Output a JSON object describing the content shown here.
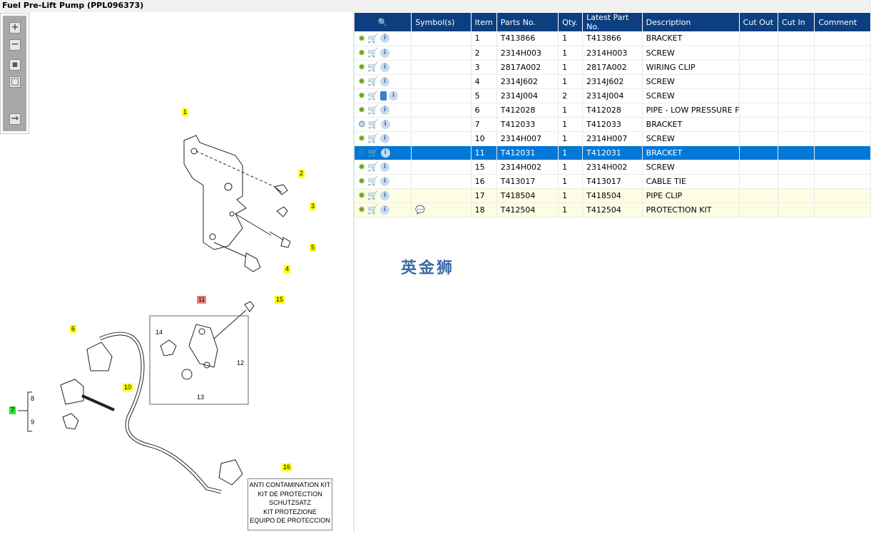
{
  "title": "Fuel Pre-Lift Pump (PPL096373)",
  "toolbar": {
    "zoom_in": "zoom-in",
    "zoom_out": "zoom-out",
    "fit": "fit",
    "actual": "actual-size",
    "export": "export"
  },
  "diagram": {
    "callouts": [
      {
        "label": "1",
        "color": "#ffff00"
      },
      {
        "label": "2",
        "color": "#ffff00"
      },
      {
        "label": "3",
        "color": "#ffff00"
      },
      {
        "label": "4",
        "color": "#ffff00"
      },
      {
        "label": "5",
        "color": "#ffff00"
      },
      {
        "label": "6",
        "color": "#ffff00"
      },
      {
        "label": "7",
        "color": "#33dd33"
      },
      {
        "label": "10",
        "color": "#ffff00"
      },
      {
        "label": "11",
        "color": "#f08080"
      },
      {
        "label": "15",
        "color": "#ffff00"
      },
      {
        "label": "16",
        "color": "#ffff00"
      }
    ],
    "sub_labels": [
      "8",
      "9",
      "12",
      "13",
      "14"
    ],
    "kit_text": [
      "ANTI CONTAMINATION KIT",
      "KIT DE PROTECTION",
      "SCHUTZSATZ",
      "KIT PROTEZIONE",
      "EQUIPO DE PROTECCION"
    ]
  },
  "watermark": "英金狮",
  "table": {
    "headers": [
      "",
      "Symbol(s)",
      "Item",
      "Parts No.",
      "Qty.",
      "Latest Part No.",
      "Description",
      "Cut Out",
      "Cut In",
      "Comment"
    ],
    "rows": [
      {
        "item": "1",
        "part": "T413866",
        "qty": "1",
        "latest": "T413866",
        "desc": "BRACKET"
      },
      {
        "item": "2",
        "part": "2314H003",
        "qty": "1",
        "latest": "2314H003",
        "desc": "SCREW"
      },
      {
        "item": "3",
        "part": "2817A002",
        "qty": "1",
        "latest": "2817A002",
        "desc": "WIRING CLIP"
      },
      {
        "item": "4",
        "part": "2314J602",
        "qty": "1",
        "latest": "2314J602",
        "desc": "SCREW"
      },
      {
        "item": "5",
        "part": "2314J004",
        "qty": "2",
        "latest": "2314J004",
        "desc": "SCREW",
        "book": true
      },
      {
        "item": "6",
        "part": "T412028",
        "qty": "1",
        "latest": "T412028",
        "desc": "PIPE - LOW PRESSURE FUE"
      },
      {
        "item": "7",
        "part": "T412033",
        "qty": "1",
        "latest": "T412033",
        "desc": "BRACKET",
        "assembly": true
      },
      {
        "item": "10",
        "part": "2314H007",
        "qty": "1",
        "latest": "2314H007",
        "desc": "SCREW"
      },
      {
        "item": "11",
        "part": "T412031",
        "qty": "1",
        "latest": "T412031",
        "desc": "BRACKET",
        "assembly": true,
        "selected": true
      },
      {
        "item": "15",
        "part": "2314H002",
        "qty": "1",
        "latest": "2314H002",
        "desc": "SCREW"
      },
      {
        "item": "16",
        "part": "T413017",
        "qty": "1",
        "latest": "T413017",
        "desc": "CABLE TIE"
      },
      {
        "item": "17",
        "part": "T418504",
        "qty": "1",
        "latest": "T418504",
        "desc": "PIPE CLIP",
        "highlight": true
      },
      {
        "item": "18",
        "part": "T412504",
        "qty": "1",
        "latest": "T412504",
        "desc": "PROTECTION KIT",
        "highlight": true,
        "symbol": "comment-alert"
      }
    ]
  },
  "colors": {
    "header": "#0d3f80",
    "selected": "#0078d7",
    "highlight": "#fdfde4"
  }
}
